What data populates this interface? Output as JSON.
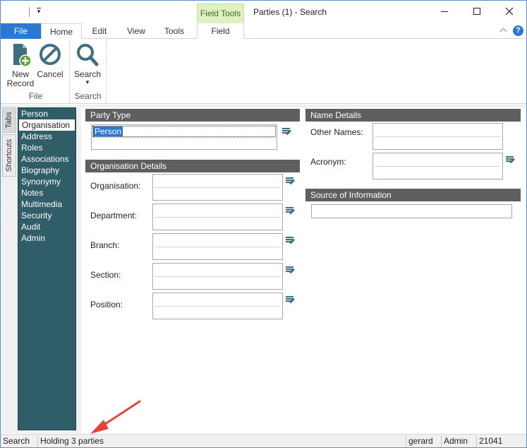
{
  "window": {
    "title": "Parties (1) - Search",
    "context_group": "Field Tools"
  },
  "ribbon_tabs": {
    "file": "File",
    "home": "Home",
    "edit": "Edit",
    "view": "View",
    "tools": "Tools",
    "field": "Field"
  },
  "ribbon": {
    "new_record": "New\nRecord",
    "cancel": "Cancel",
    "search": "Search",
    "group_file": "File",
    "group_search": "Search"
  },
  "side_tabs": {
    "tabs": "Tabs",
    "shortcuts": "Shortcuts"
  },
  "nav": {
    "items": [
      "Person",
      "Organisation",
      "Address",
      "Roles",
      "Associations",
      "Biography",
      "Synonymy",
      "Notes",
      "Multimedia",
      "Security",
      "Audit",
      "Admin"
    ],
    "active_index": 1
  },
  "party_type": {
    "header": "Party Type",
    "value": "Person"
  },
  "organisation_details": {
    "header": "Organisation Details",
    "organisation_label": "Organisation:",
    "department_label": "Department:",
    "branch_label": "Branch:",
    "section_label": "Section:",
    "position_label": "Position:"
  },
  "name_details": {
    "header": "Name Details",
    "other_names_label": "Other Names:",
    "acronym_label": "Acronym:"
  },
  "source": {
    "header": "Source of Information"
  },
  "statusbar": {
    "mode": "Search",
    "message": "Holding 3 parties",
    "user": "gerard",
    "role": "Admin",
    "code": "21041"
  },
  "colors": {
    "file_tab": "#2b78d0",
    "nav_bg": "#2f5d68",
    "section_header": "#5f5f5f",
    "context_group": "#dff0c2",
    "annotation_arrow": "#e8433a"
  }
}
